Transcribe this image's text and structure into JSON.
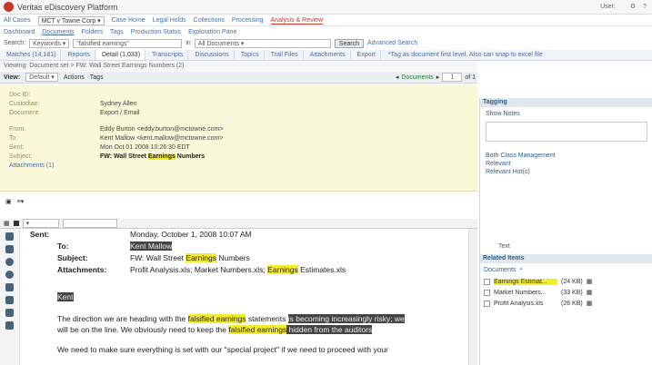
{
  "titlebar": {
    "app_title": "Veritas eDiscovery Platform",
    "user_label": "User:",
    "user_name": "",
    "icons": [
      "settings-icon",
      "help-icon"
    ]
  },
  "casebar": {
    "case_label": "All Cases",
    "case_value": "MCT v Towne Corp",
    "links": [
      "Case Home",
      "Legal Holds",
      "Collections",
      "Processing",
      "Analysis & Review"
    ],
    "active_link_index": 4
  },
  "subnav": {
    "items": [
      "Dashboard",
      "Documents",
      "Folders",
      "Tags",
      "Production Status",
      "Exploration Pane"
    ]
  },
  "search": {
    "search_label": "Search:",
    "scope_value": "Keywords",
    "query_value": "\"falsified earnings\"",
    "in_label": "in",
    "in_value": "All Documents",
    "button_label": "Search",
    "advanced_label": "Advanced Search"
  },
  "tabs": {
    "items": [
      "Matches (14,181)",
      "Reports",
      "Detail (1,033)",
      "Transcripts",
      "Discussions",
      "Topics",
      "Trail Files",
      "Attachments",
      "Export"
    ],
    "active_index": 2,
    "trailing_text": "*Tag as document first level. Also can snap to excel file"
  },
  "breadcrumb": {
    "text": "Viewing: Document set > FW: Wall Street Earnings Numbers (2)"
  },
  "view_toolbar": {
    "view_label": "View:",
    "view_value": "Default",
    "actions_label": "Actions",
    "tags_label": "Tags",
    "documents_label": "Documents",
    "page_current": "1",
    "page_of": "of 1"
  },
  "email_header": {
    "labels": [
      "Doc ID:",
      "Custodian:",
      "Document:",
      "From:",
      "To:",
      "Sent:",
      "Subject:",
      "Attachments (1)"
    ],
    "from": "Eddy Burton <eddy.burton@mctowne.com>",
    "to": "Kent Mallow <kent.mallow@mctowne.com>",
    "sent": "Mon Oct 01 2008 10:26:30 EDT",
    "subject_prefix": "FW: Wall Street ",
    "subject_highlight": "Earnings",
    "subject_suffix": " Numbers",
    "custodian": "Sydney Allen",
    "document": "Export / Email"
  },
  "doc_body": {
    "sent_label": "Sent:",
    "sent_value": "Monday, October 1, 2008 10:07 AM",
    "to_label": "To:",
    "to_value": "Kent Mallow",
    "subject_label": "Subject:",
    "subject_prefix": "FW: Wall Street ",
    "subject_highlight": "Earnings",
    "subject_suffix": " Numbers",
    "attachments_label": "Attachments:",
    "attachments_prefix": "Profit Analysis.xls; Market Numbers.xls; ",
    "attachments_highlight": "Earnings",
    "attachments_suffix": " Estimates.xls",
    "name_tag": "Kent",
    "para1_a": "The direction we are heading with the ",
    "para1_hl": "falsified earnings",
    "para1_b": " statements ",
    "para1_sel": "is becoming increasingly risky; we",
    "para2_a": "will be on the line. We obviously need to keep the ",
    "para2_hl": "falsified earnings",
    "para2_sel": " hidden from the auditors",
    "para3": "We need to make sure everything is set with our \"special project\" if we need to proceed with your"
  },
  "right_panel": {
    "tagging_title": "Tagging",
    "show_notes": "Show Notes",
    "tag_items": [
      "Both Class Management",
      "Relevant",
      "Relevant Hot(s)"
    ],
    "related_title": "Related Items",
    "documents_label": "Documents",
    "related_rows": [
      {
        "name": "Earnings Estimat...",
        "size": "(24 KB)",
        "highlight": true
      },
      {
        "name": "Market Numbers...",
        "size": "(33 KB)",
        "highlight": false
      },
      {
        "name": "Profit Analysis.xls",
        "size": "(26 KB)",
        "highlight": false
      }
    ],
    "text_label": "Text"
  },
  "colors": {
    "brand": "#c8362c",
    "link": "#4a6ea8",
    "header_bg": "#fbf7d9",
    "highlight": "#f4ec2e",
    "panel_head": "#dfe7ef"
  }
}
